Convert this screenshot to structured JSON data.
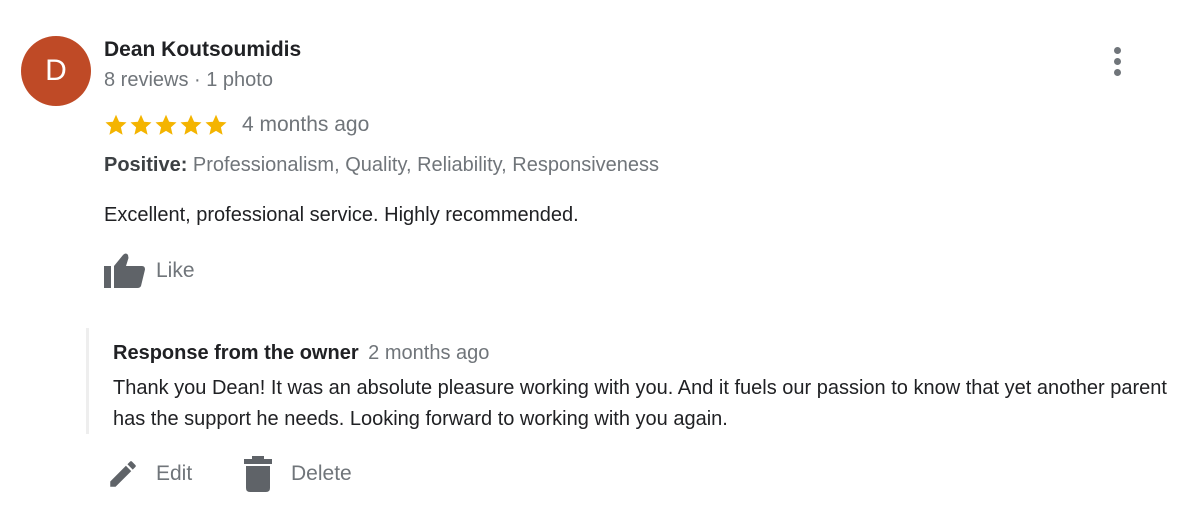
{
  "reviewer": {
    "avatar_initial": "D",
    "name": "Dean Koutsoumidis",
    "meta": "8 reviews · 1 photo"
  },
  "review": {
    "rating": 5,
    "rating_max": 5,
    "time": "4 months ago",
    "positive_label": "Positive:",
    "positive_values": "Professionalism, Quality, Reliability, Responsiveness",
    "text": "Excellent, professional service. Highly recommended."
  },
  "actions": {
    "like_label": "Like",
    "edit_label": "Edit",
    "delete_label": "Delete"
  },
  "owner_response": {
    "title": "Response from the owner",
    "time": "2 months ago",
    "text": "Thank you Dean! It was an absolute pleasure working with you. And it fuels our passion to know that yet another parent has the support he needs. Looking forward to working with you again."
  },
  "icons": {
    "more": "more-vert-icon",
    "star": "star-icon",
    "like": "thumb-up-icon",
    "edit": "pencil-icon",
    "delete": "trash-icon"
  },
  "colors": {
    "avatar_bg": "#bf4a26",
    "star": "#f4b400",
    "secondary_text": "#70757a",
    "primary_text": "#202124"
  }
}
